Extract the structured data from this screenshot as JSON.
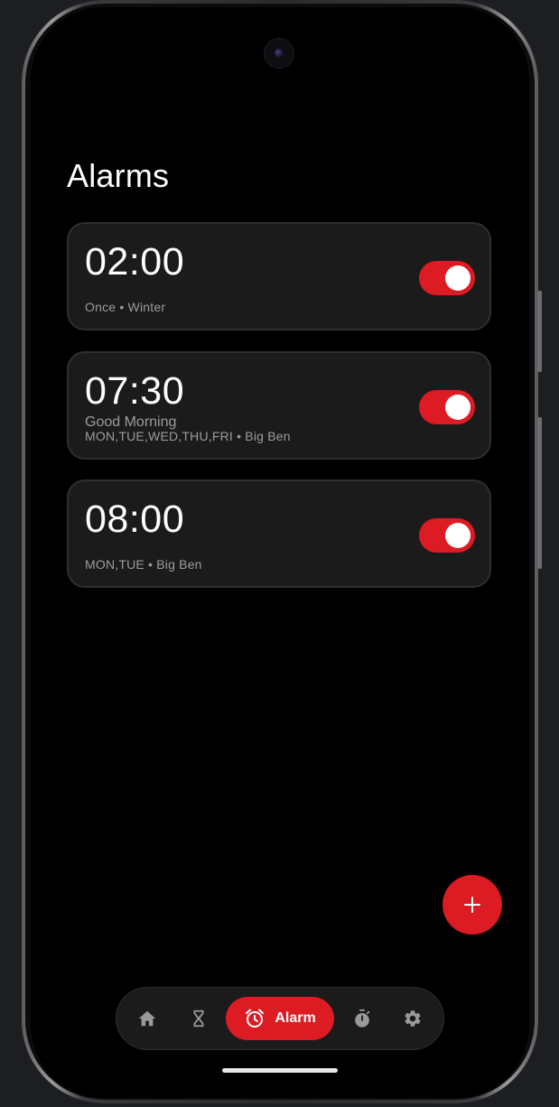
{
  "page": {
    "title": "Alarms"
  },
  "alarms": [
    {
      "time": "02:00",
      "label": "",
      "details": "Once • Winter",
      "enabled": true
    },
    {
      "time": "07:30",
      "label": "Good Morning",
      "details": "MON,TUE,WED,THU,FRI • Big Ben",
      "enabled": true
    },
    {
      "time": "08:00",
      "label": "",
      "details": "MON,TUE • Big Ben",
      "enabled": true
    }
  ],
  "fab": {
    "icon": "plus-icon"
  },
  "nav": {
    "items": [
      {
        "icon": "home-icon",
        "label": ""
      },
      {
        "icon": "hourglass-icon",
        "label": ""
      },
      {
        "icon": "alarm-clock-icon",
        "label": "Alarm",
        "active": true
      },
      {
        "icon": "stopwatch-icon",
        "label": ""
      },
      {
        "icon": "gear-icon",
        "label": ""
      }
    ]
  },
  "colors": {
    "accent": "#dc1b23",
    "background": "#000000",
    "card": "#1b1b1b",
    "text_primary": "#ffffff",
    "text_secondary": "#9c9c9c",
    "nav_icon": "#9a9a9a"
  }
}
